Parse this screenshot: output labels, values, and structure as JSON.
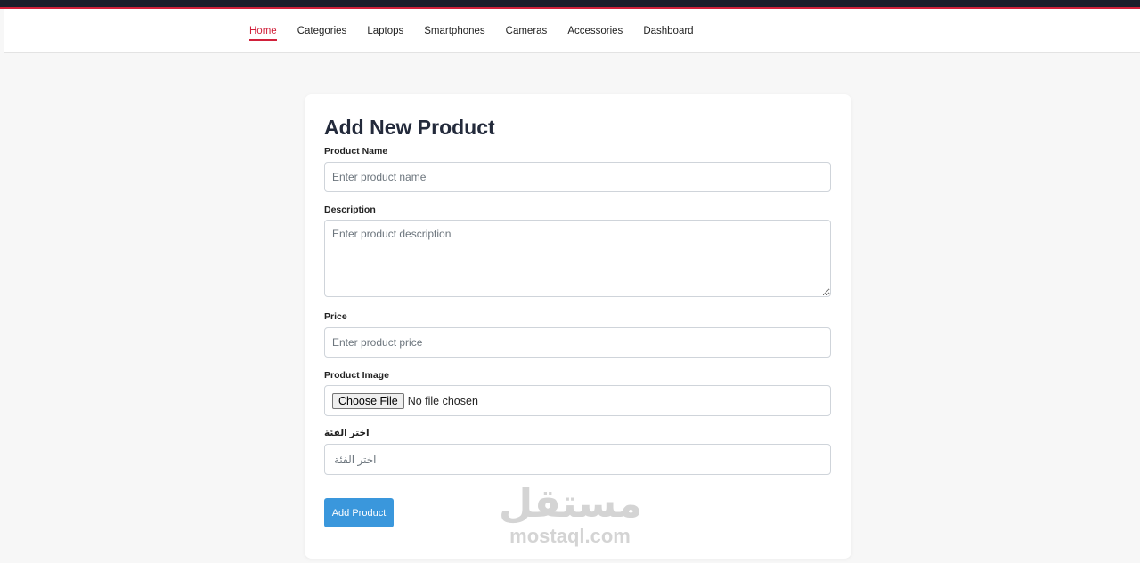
{
  "nav": {
    "items": [
      {
        "label": "Home",
        "active": true
      },
      {
        "label": "Categories"
      },
      {
        "label": "Laptops"
      },
      {
        "label": "Smartphones"
      },
      {
        "label": "Cameras"
      },
      {
        "label": "Accessories"
      },
      {
        "label": "Dashboard"
      }
    ]
  },
  "form": {
    "title": "Add New Product",
    "name_label": "Product Name",
    "name_placeholder": "Enter product name",
    "description_label": "Description",
    "description_placeholder": "Enter product description",
    "price_label": "Price",
    "price_placeholder": "Enter product price",
    "image_label": "Product Image",
    "file_button": "Choose File",
    "file_status": "No file chosen",
    "category_label": "اختر الفئة",
    "category_placeholder": "اختر الفئة",
    "submit_label": "Add Product"
  },
  "watermark": {
    "arabic": "مستقل",
    "latin": "mostaql.com"
  },
  "colors": {
    "accent": "#d1213b",
    "topbar": "#1b1e2b",
    "button": "#3a97dc",
    "background": "#f7f7f7"
  }
}
